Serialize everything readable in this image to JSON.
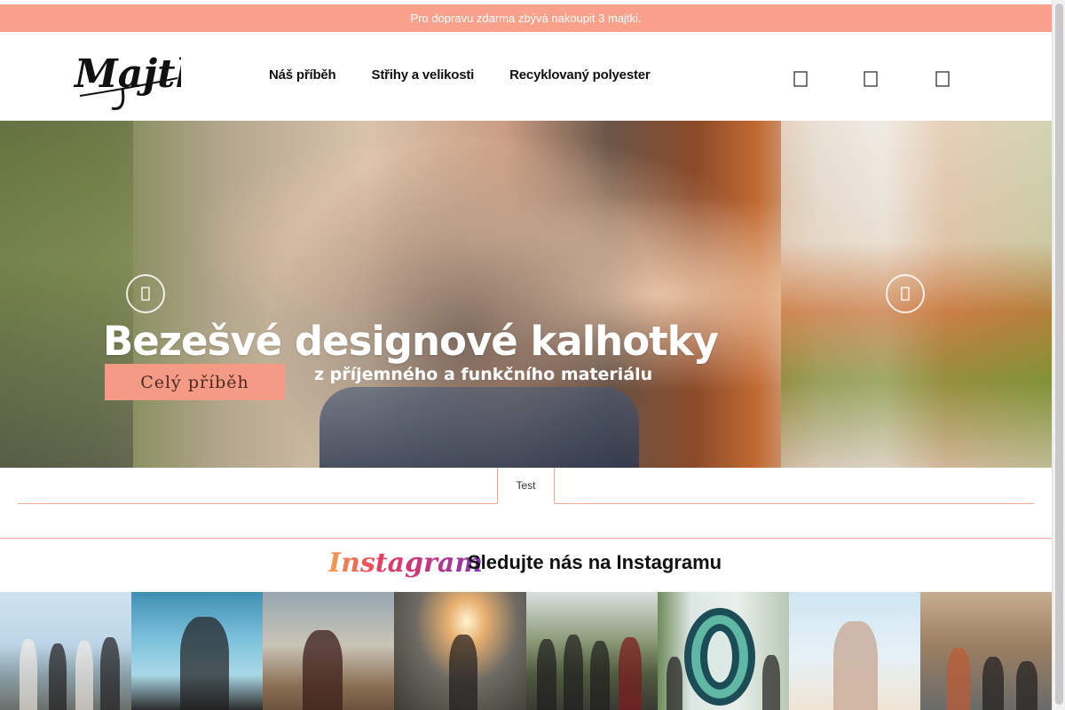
{
  "promo": {
    "text": "Pro dopravu zdarma zbývá nakoupit 3 majtki."
  },
  "header": {
    "logo_text": "Majtki",
    "nav": [
      {
        "label": "Náš příběh"
      },
      {
        "label": "Střihy a velikosti"
      },
      {
        "label": "Recyklovaný polyester"
      }
    ],
    "icons": [
      "search-icon",
      "user-icon",
      "cart-icon"
    ]
  },
  "hero": {
    "title": "Bezešvé designové kalhotky",
    "subtitle": "z příjemného a funkčního materiálu",
    "cta_label": "Celý příběh",
    "prev_icon": "chevron-left-icon",
    "next_icon": "chevron-right-icon"
  },
  "tabs": [
    {
      "label": "Test"
    }
  ],
  "instagram": {
    "logo_text": "Instagram",
    "title": "Sledujte nás na Instagramu",
    "tile_count": 8
  },
  "colors": {
    "accent": "#f9a18a",
    "cta": "#f59a84",
    "divider": "#f0a896"
  }
}
